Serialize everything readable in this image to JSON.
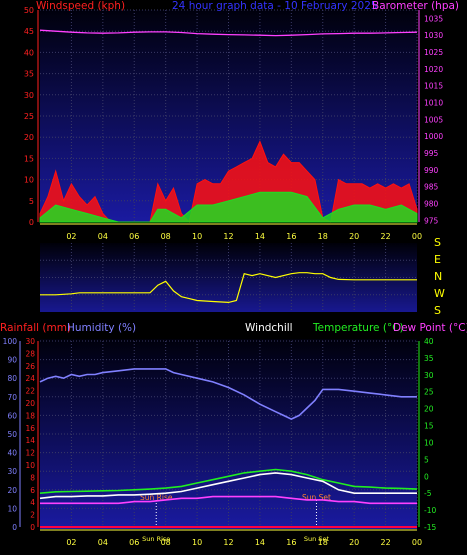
{
  "colors": {
    "background": "#000000",
    "plot_bg_top": "#000010",
    "plot_bg_bottom": "#1a1a9a",
    "grid": "#3a3a66",
    "wind_axis": "#ff2020",
    "baro_axis": "#ff40ff",
    "humidity_axis": "#8080ff",
    "temp_axis": "#22ee22",
    "time_axis": "#ffff40",
    "title": "#3333ff",
    "windchill": "#ffffff",
    "direction": "#ffff00",
    "sun_label": "#ff8030",
    "zero_line": "#ff0040"
  },
  "chart_data": [
    {
      "type": "area",
      "title": "24 hour graph data - 10 February 2025",
      "ylabel_left": "Windspeed (kph)",
      "ylabel_right": "Barometer (hpa)",
      "x_ticks": [
        "02",
        "04",
        "06",
        "08",
        "10",
        "12",
        "14",
        "16",
        "18",
        "20",
        "22",
        "00"
      ],
      "x_range_hours": [
        0,
        24
      ],
      "y_left_ticks": [
        0,
        5,
        10,
        15,
        20,
        25,
        30,
        35,
        40,
        45,
        50
      ],
      "ylim_left": [
        0,
        50
      ],
      "y_right_ticks": [
        975,
        980,
        985,
        990,
        995,
        1000,
        1005,
        1010,
        1015,
        1020,
        1025,
        1030,
        1035
      ],
      "ylim_right": [
        974.5,
        1037.5
      ],
      "grid": true,
      "series": [
        {
          "name": "Barometer",
          "axis": "right",
          "color": "#ff40ff",
          "x": [
            0,
            1,
            2,
            3,
            4,
            5,
            6,
            7,
            8,
            9,
            10,
            11,
            12,
            13,
            14,
            15,
            16,
            17,
            18,
            19,
            20,
            21,
            22,
            23,
            24
          ],
          "y": [
            1031.5,
            1031.2,
            1030.9,
            1030.7,
            1030.6,
            1030.7,
            1030.9,
            1031.0,
            1031.0,
            1030.8,
            1030.5,
            1030.3,
            1030.2,
            1030.1,
            1030.0,
            1029.9,
            1030.0,
            1030.2,
            1030.4,
            1030.5,
            1030.6,
            1030.6,
            1030.7,
            1030.8,
            1030.9
          ]
        },
        {
          "name": "Gust",
          "axis": "left",
          "color": "#ff1010",
          "x": [
            0,
            0.5,
            1,
            1.5,
            2,
            2.5,
            3,
            3.5,
            4,
            4.5,
            5,
            6,
            7,
            7.5,
            8,
            8.5,
            9,
            9.5,
            10,
            10.5,
            11,
            11.5,
            12,
            12.5,
            13,
            13.5,
            14,
            14.5,
            15,
            15.5,
            16,
            16.5,
            17,
            17.5,
            18,
            18.5,
            19,
            19.5,
            20,
            20.5,
            21,
            21.5,
            22,
            22.5,
            23,
            23.5,
            24
          ],
          "y": [
            2,
            6,
            12,
            5,
            9,
            6,
            4,
            6,
            2,
            0,
            0,
            0,
            0,
            9,
            5,
            8,
            2,
            0,
            9,
            10,
            9,
            9,
            12,
            13,
            14,
            15,
            19,
            14,
            13,
            16,
            14,
            14,
            12,
            10,
            1,
            0,
            10,
            9,
            9,
            9,
            8,
            9,
            8,
            9,
            8,
            9,
            3
          ]
        },
        {
          "name": "Average",
          "axis": "left",
          "color": "#20dd20",
          "x": [
            0,
            1,
            2,
            3,
            4,
            5,
            6,
            7,
            7.5,
            8,
            9,
            10,
            11,
            12,
            13,
            14,
            15,
            16,
            17,
            18,
            19,
            20,
            21,
            22,
            23,
            24
          ],
          "y": [
            1,
            4,
            3,
            2,
            1,
            0,
            0,
            0,
            3,
            3,
            1,
            4,
            4,
            5,
            6,
            7,
            7,
            7,
            6,
            1,
            3,
            4,
            4,
            3,
            4,
            2
          ]
        }
      ]
    },
    {
      "type": "line",
      "ylabel_right": [
        "S",
        "E",
        "N",
        "W",
        "S"
      ],
      "x_range_hours": [
        0,
        24
      ],
      "ylim": [
        0,
        360
      ],
      "series": [
        {
          "name": "Wind direction",
          "color": "#ffff00",
          "x": [
            0,
            1,
            2,
            2.5,
            3,
            4,
            5,
            6,
            7,
            7.5,
            8,
            8.5,
            9,
            9.5,
            10,
            11,
            12,
            12.5,
            13,
            13.5,
            14,
            15,
            16,
            16.5,
            17,
            17.5,
            18,
            18.5,
            19,
            20,
            22,
            24
          ],
          "y": [
            90,
            90,
            95,
            100,
            100,
            100,
            100,
            100,
            100,
            140,
            160,
            110,
            80,
            70,
            60,
            55,
            50,
            60,
            200,
            190,
            200,
            180,
            200,
            205,
            205,
            200,
            200,
            180,
            170,
            168,
            168,
            168
          ]
        }
      ]
    },
    {
      "type": "line",
      "ylabel_left": [
        "Rainfall (mm)",
        "Humidity (%)"
      ],
      "ylabel_right": [
        "Temperature (°C)",
        "Dew Point (°C)"
      ],
      "label_center": "Windchill",
      "x_ticks": [
        "02",
        "04",
        "06",
        "08",
        "10",
        "12",
        "14",
        "16",
        "18",
        "20",
        "22",
        "00"
      ],
      "x_range_hours": [
        0,
        24
      ],
      "y_rain_ticks": [
        0,
        2,
        4,
        6,
        8,
        10,
        12,
        14,
        16,
        18,
        20,
        22,
        24,
        26,
        28,
        30
      ],
      "ylim_rain": [
        0,
        30
      ],
      "y_hum_ticks": [
        0,
        10,
        20,
        30,
        40,
        50,
        60,
        70,
        80,
        90,
        100
      ],
      "ylim_hum": [
        0,
        100
      ],
      "y_temp_ticks": [
        -15,
        -10,
        -5,
        0,
        5,
        10,
        15,
        20,
        25,
        30,
        35,
        40
      ],
      "ylim_temp": [
        -15,
        40
      ],
      "grid": true,
      "sun_events": [
        {
          "label": "Sun Rise",
          "hour": 7.4
        },
        {
          "label": "Sun Set",
          "hour": 17.6
        }
      ],
      "series": [
        {
          "name": "Humidity",
          "axis": "humidity",
          "color": "#8080ff",
          "x": [
            0,
            0.5,
            1,
            1.5,
            2,
            2.5,
            3,
            3.5,
            4,
            5,
            6,
            7,
            8,
            8.5,
            9,
            10,
            11,
            12,
            13,
            14,
            15,
            15.5,
            16,
            16.5,
            17,
            17.5,
            18,
            19,
            20,
            21,
            22,
            23,
            24
          ],
          "y": [
            78,
            80,
            81,
            80,
            82,
            81,
            82,
            82,
            83,
            84,
            85,
            85,
            85,
            83,
            82,
            80,
            78,
            75,
            71,
            66,
            62,
            60,
            58,
            60,
            64,
            68,
            74,
            74,
            73,
            72,
            71,
            70,
            70
          ]
        },
        {
          "name": "Temperature",
          "axis": "temp",
          "color": "#20ee20",
          "x": [
            0,
            1,
            2,
            3,
            4,
            5,
            6,
            7,
            8,
            9,
            10,
            11,
            12,
            13,
            14,
            15,
            16,
            17,
            18,
            19,
            20,
            21,
            22,
            23,
            24
          ],
          "y": [
            -5,
            -4.6,
            -4.5,
            -4.4,
            -4.3,
            -4.2,
            -4,
            -3.8,
            -3.5,
            -3,
            -2,
            -1,
            0,
            1,
            1.5,
            2,
            1.5,
            0.5,
            -1,
            -2,
            -3,
            -3.2,
            -3.5,
            -3.6,
            -3.8
          ]
        },
        {
          "name": "Windchill",
          "axis": "temp",
          "color": "#ffffff",
          "x": [
            0,
            1,
            2,
            3,
            4,
            5,
            6,
            7,
            8,
            9,
            10,
            11,
            12,
            13,
            14,
            15,
            16,
            17,
            18,
            19,
            20,
            21,
            22,
            23,
            24
          ],
          "y": [
            -6.5,
            -6,
            -6,
            -5.8,
            -5.8,
            -5.5,
            -5.5,
            -5.3,
            -5,
            -4.5,
            -3.5,
            -2.5,
            -1.5,
            -0.5,
            0.5,
            1,
            0.5,
            -0.5,
            -1.5,
            -4,
            -5,
            -5,
            -5,
            -5,
            -5
          ]
        },
        {
          "name": "Dew Point",
          "axis": "temp",
          "color": "#ff40ff",
          "x": [
            0,
            1,
            2,
            3,
            4,
            5,
            6,
            7,
            8,
            9,
            10,
            11,
            12,
            13,
            14,
            15,
            16,
            17,
            18,
            19,
            20,
            21,
            22,
            23,
            24
          ],
          "y": [
            -8,
            -8,
            -8,
            -8,
            -8,
            -8,
            -7.5,
            -7.5,
            -7,
            -6.5,
            -6.5,
            -6,
            -6,
            -6,
            -6,
            -6,
            -6.5,
            -7,
            -7,
            -7.5,
            -7.5,
            -8,
            -8,
            -8,
            -8
          ]
        },
        {
          "name": "Rainfall",
          "axis": "rain",
          "color": "#ff0040",
          "x": [
            0,
            24
          ],
          "y": [
            0,
            0
          ]
        }
      ]
    }
  ]
}
